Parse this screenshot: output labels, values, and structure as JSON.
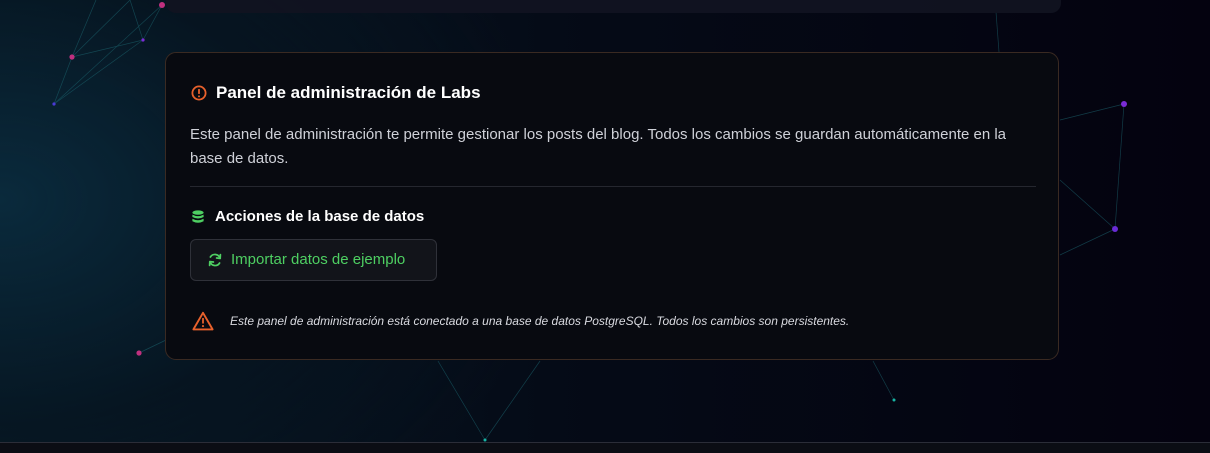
{
  "admin_panel": {
    "title": "Panel de administración de Labs",
    "description": "Este panel de administración te permite gestionar los posts del blog. Todos los cambios se guardan automáticamente en la base de datos.",
    "header_icon": "info-circle-icon",
    "database_section": {
      "title": "Acciones de la base de datos",
      "icon": "database-icon",
      "import_button_label": "Importar datos de ejemplo",
      "import_button_icon": "refresh-icon"
    },
    "warning": {
      "icon": "warning-triangle-icon",
      "text": "Este panel de administración está conectado a una base de datos PostgreSQL. Todos los cambios son persistentes."
    }
  },
  "colors": {
    "accent_orange": "#e8612c",
    "accent_green": "#4ecf62",
    "node_magenta": "#c0307f",
    "node_purple": "#7a2bd6",
    "node_teal": "#17b3a3"
  }
}
